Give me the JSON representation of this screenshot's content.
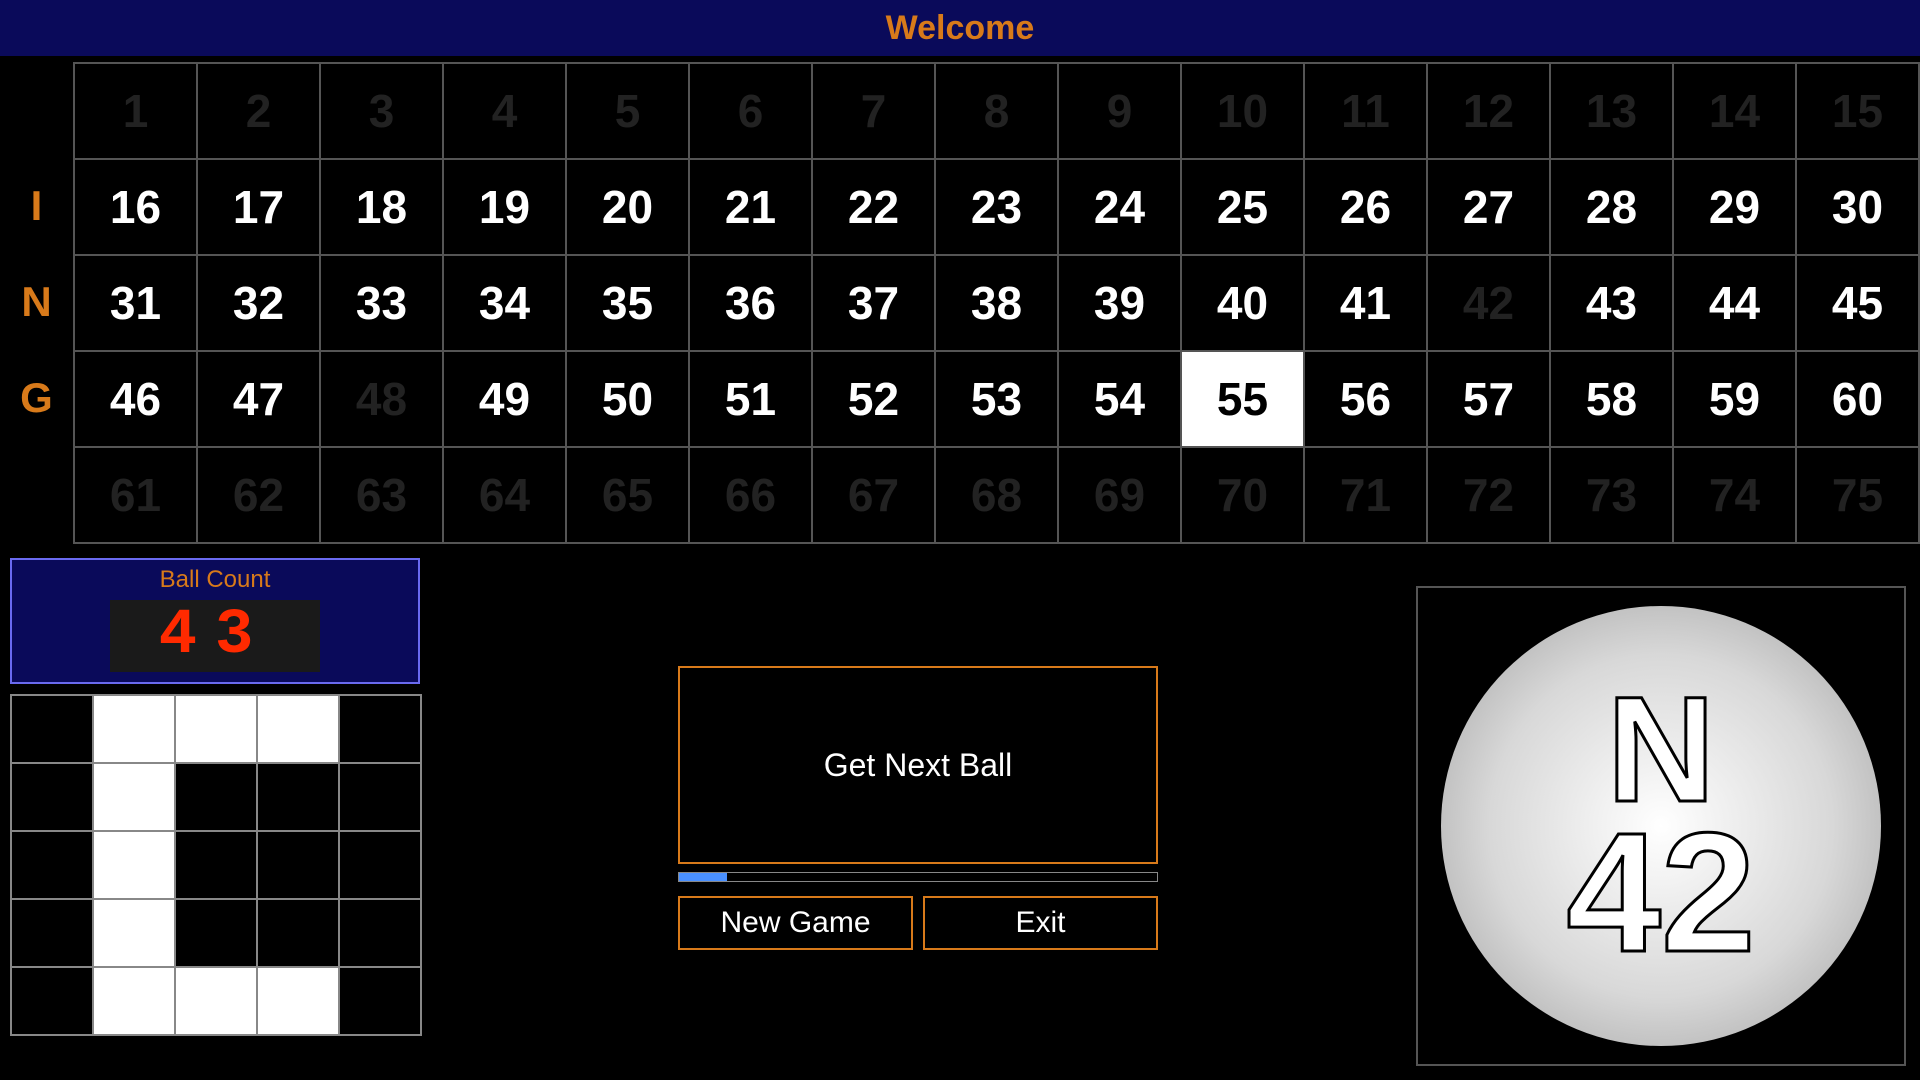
{
  "header": {
    "title": "Welcome"
  },
  "row_labels": [
    "",
    "I",
    "N",
    "G",
    ""
  ],
  "board": {
    "rows": [
      [
        {
          "n": 1,
          "s": "dim"
        },
        {
          "n": 2,
          "s": "dim"
        },
        {
          "n": 3,
          "s": "dim"
        },
        {
          "n": 4,
          "s": "dim"
        },
        {
          "n": 5,
          "s": "dim"
        },
        {
          "n": 6,
          "s": "dim"
        },
        {
          "n": 7,
          "s": "dim"
        },
        {
          "n": 8,
          "s": "dim"
        },
        {
          "n": 9,
          "s": "dim"
        },
        {
          "n": 10,
          "s": "dim"
        },
        {
          "n": 11,
          "s": "dim"
        },
        {
          "n": 12,
          "s": "dim"
        },
        {
          "n": 13,
          "s": "dim"
        },
        {
          "n": 14,
          "s": "dim"
        },
        {
          "n": 15,
          "s": "dim"
        }
      ],
      [
        {
          "n": 16,
          "s": "bright"
        },
        {
          "n": 17,
          "s": "bright"
        },
        {
          "n": 18,
          "s": "bright"
        },
        {
          "n": 19,
          "s": "bright"
        },
        {
          "n": 20,
          "s": "bright"
        },
        {
          "n": 21,
          "s": "bright"
        },
        {
          "n": 22,
          "s": "bright"
        },
        {
          "n": 23,
          "s": "bright"
        },
        {
          "n": 24,
          "s": "bright"
        },
        {
          "n": 25,
          "s": "bright"
        },
        {
          "n": 26,
          "s": "bright"
        },
        {
          "n": 27,
          "s": "bright"
        },
        {
          "n": 28,
          "s": "bright"
        },
        {
          "n": 29,
          "s": "bright"
        },
        {
          "n": 30,
          "s": "bright"
        }
      ],
      [
        {
          "n": 31,
          "s": "bright"
        },
        {
          "n": 32,
          "s": "bright"
        },
        {
          "n": 33,
          "s": "bright"
        },
        {
          "n": 34,
          "s": "bright"
        },
        {
          "n": 35,
          "s": "bright"
        },
        {
          "n": 36,
          "s": "bright"
        },
        {
          "n": 37,
          "s": "bright"
        },
        {
          "n": 38,
          "s": "bright"
        },
        {
          "n": 39,
          "s": "bright"
        },
        {
          "n": 40,
          "s": "bright"
        },
        {
          "n": 41,
          "s": "bright"
        },
        {
          "n": 42,
          "s": "dim"
        },
        {
          "n": 43,
          "s": "bright"
        },
        {
          "n": 44,
          "s": "bright"
        },
        {
          "n": 45,
          "s": "bright"
        }
      ],
      [
        {
          "n": 46,
          "s": "bright"
        },
        {
          "n": 47,
          "s": "bright"
        },
        {
          "n": 48,
          "s": "dim"
        },
        {
          "n": 49,
          "s": "bright"
        },
        {
          "n": 50,
          "s": "bright"
        },
        {
          "n": 51,
          "s": "bright"
        },
        {
          "n": 52,
          "s": "bright"
        },
        {
          "n": 53,
          "s": "bright"
        },
        {
          "n": 54,
          "s": "bright"
        },
        {
          "n": 55,
          "s": "current"
        },
        {
          "n": 56,
          "s": "bright"
        },
        {
          "n": 57,
          "s": "bright"
        },
        {
          "n": 58,
          "s": "bright"
        },
        {
          "n": 59,
          "s": "bright"
        },
        {
          "n": 60,
          "s": "bright"
        }
      ],
      [
        {
          "n": 61,
          "s": "dim"
        },
        {
          "n": 62,
          "s": "dim"
        },
        {
          "n": 63,
          "s": "dim"
        },
        {
          "n": 64,
          "s": "dim"
        },
        {
          "n": 65,
          "s": "dim"
        },
        {
          "n": 66,
          "s": "dim"
        },
        {
          "n": 67,
          "s": "dim"
        },
        {
          "n": 68,
          "s": "dim"
        },
        {
          "n": 69,
          "s": "dim"
        },
        {
          "n": 70,
          "s": "dim"
        },
        {
          "n": 71,
          "s": "dim"
        },
        {
          "n": 72,
          "s": "dim"
        },
        {
          "n": 73,
          "s": "dim"
        },
        {
          "n": 74,
          "s": "dim"
        },
        {
          "n": 75,
          "s": "dim"
        }
      ]
    ]
  },
  "ball_count": {
    "label": "Ball Count",
    "value": "43"
  },
  "pattern": [
    [
      0,
      1,
      1,
      1,
      0
    ],
    [
      0,
      1,
      0,
      0,
      0
    ],
    [
      0,
      1,
      0,
      0,
      0
    ],
    [
      0,
      1,
      0,
      0,
      0
    ],
    [
      0,
      1,
      1,
      1,
      0
    ]
  ],
  "controls": {
    "get_next": "Get Next Ball",
    "new_game": "New Game",
    "exit": "Exit",
    "progress_pct": 10
  },
  "current_ball": {
    "letter": "N",
    "number": "42"
  }
}
